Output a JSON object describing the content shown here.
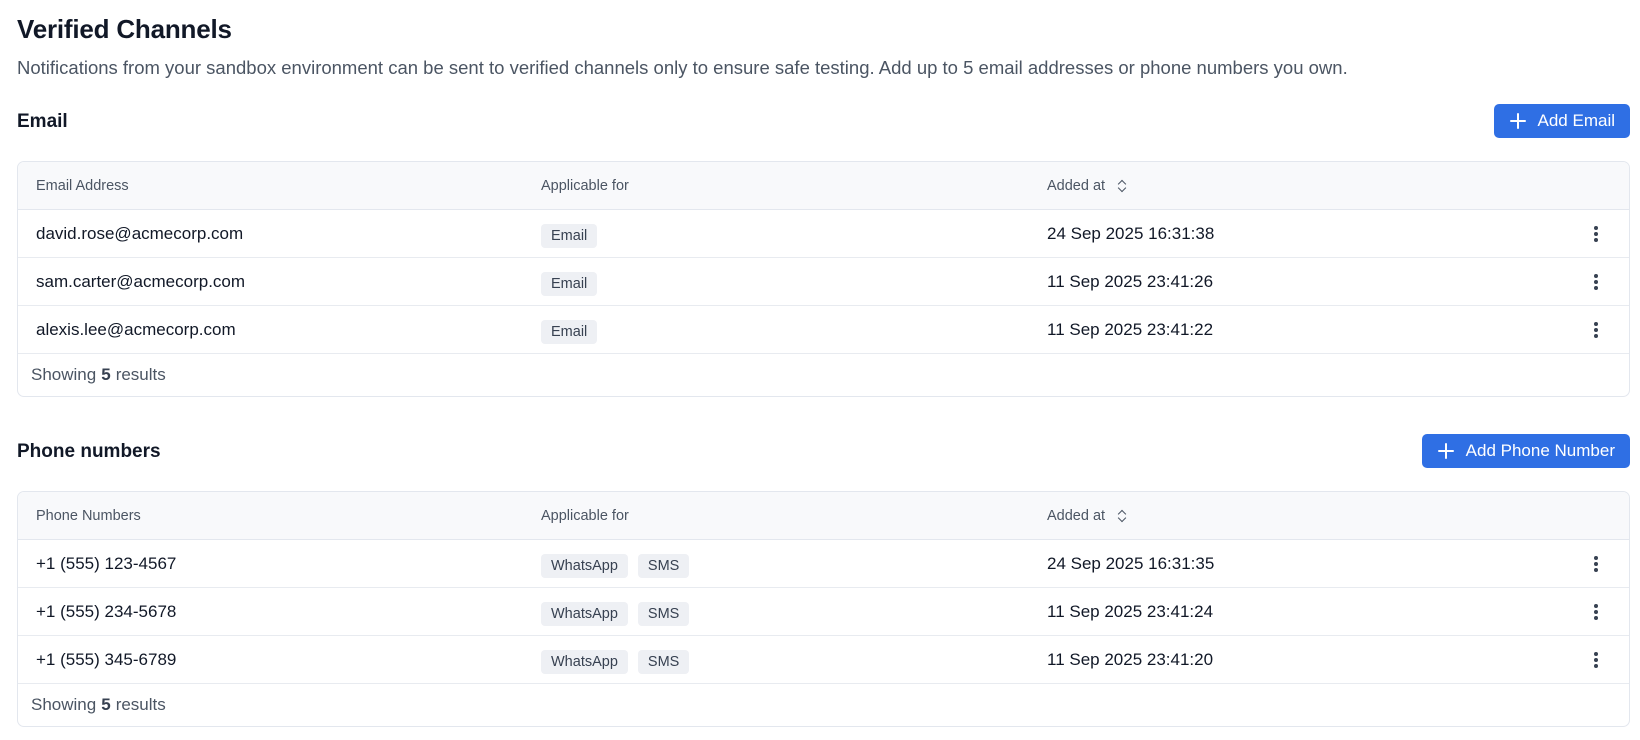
{
  "page": {
    "title": "Verified Channels",
    "subtitle": "Notifications from your sandbox environment can be sent to verified channels only to ensure safe testing. Add up to 5 email addresses or phone numbers you own."
  },
  "email": {
    "section_title": "Email",
    "add_button_label": "Add Email",
    "columns": [
      "Email Address",
      "Applicable for",
      "Added at"
    ],
    "rows": [
      {
        "address": "david.rose@acmecorp.com",
        "tags": [
          "Email"
        ],
        "added_at": "24 Sep 2025 16:31:38"
      },
      {
        "address": "sam.carter@acmecorp.com",
        "tags": [
          "Email"
        ],
        "added_at": "11 Sep 2025 23:41:26"
      },
      {
        "address": "alexis.lee@acmecorp.com",
        "tags": [
          "Email"
        ],
        "added_at": "11 Sep 2025 23:41:22"
      }
    ],
    "footer": {
      "prefix": "Showing",
      "count": "5",
      "suffix": "results"
    }
  },
  "phone": {
    "section_title": "Phone numbers",
    "add_button_label": "Add Phone Number",
    "columns": [
      "Phone Numbers",
      "Applicable for",
      "Added at"
    ],
    "rows": [
      {
        "number": "+1 (555) 123-4567",
        "tags": [
          "WhatsApp",
          "SMS"
        ],
        "added_at": "24 Sep 2025 16:31:35"
      },
      {
        "number": "+1 (555) 234-5678",
        "tags": [
          "WhatsApp",
          "SMS"
        ],
        "added_at": "11 Sep 2025 23:41:24"
      },
      {
        "number": "+1 (555) 345-6789",
        "tags": [
          "WhatsApp",
          "SMS"
        ],
        "added_at": "11 Sep 2025 23:41:20"
      }
    ],
    "footer": {
      "prefix": "Showing",
      "count": "5",
      "suffix": "results"
    }
  },
  "icons": {
    "add": "plus-icon",
    "sort": "sort-icon",
    "row_menu": "more-vertical-icon"
  },
  "colors": {
    "primary_button": "#2f6fe4",
    "chip_bg": "#eef0f4",
    "header_bg": "#f8f9fb"
  }
}
